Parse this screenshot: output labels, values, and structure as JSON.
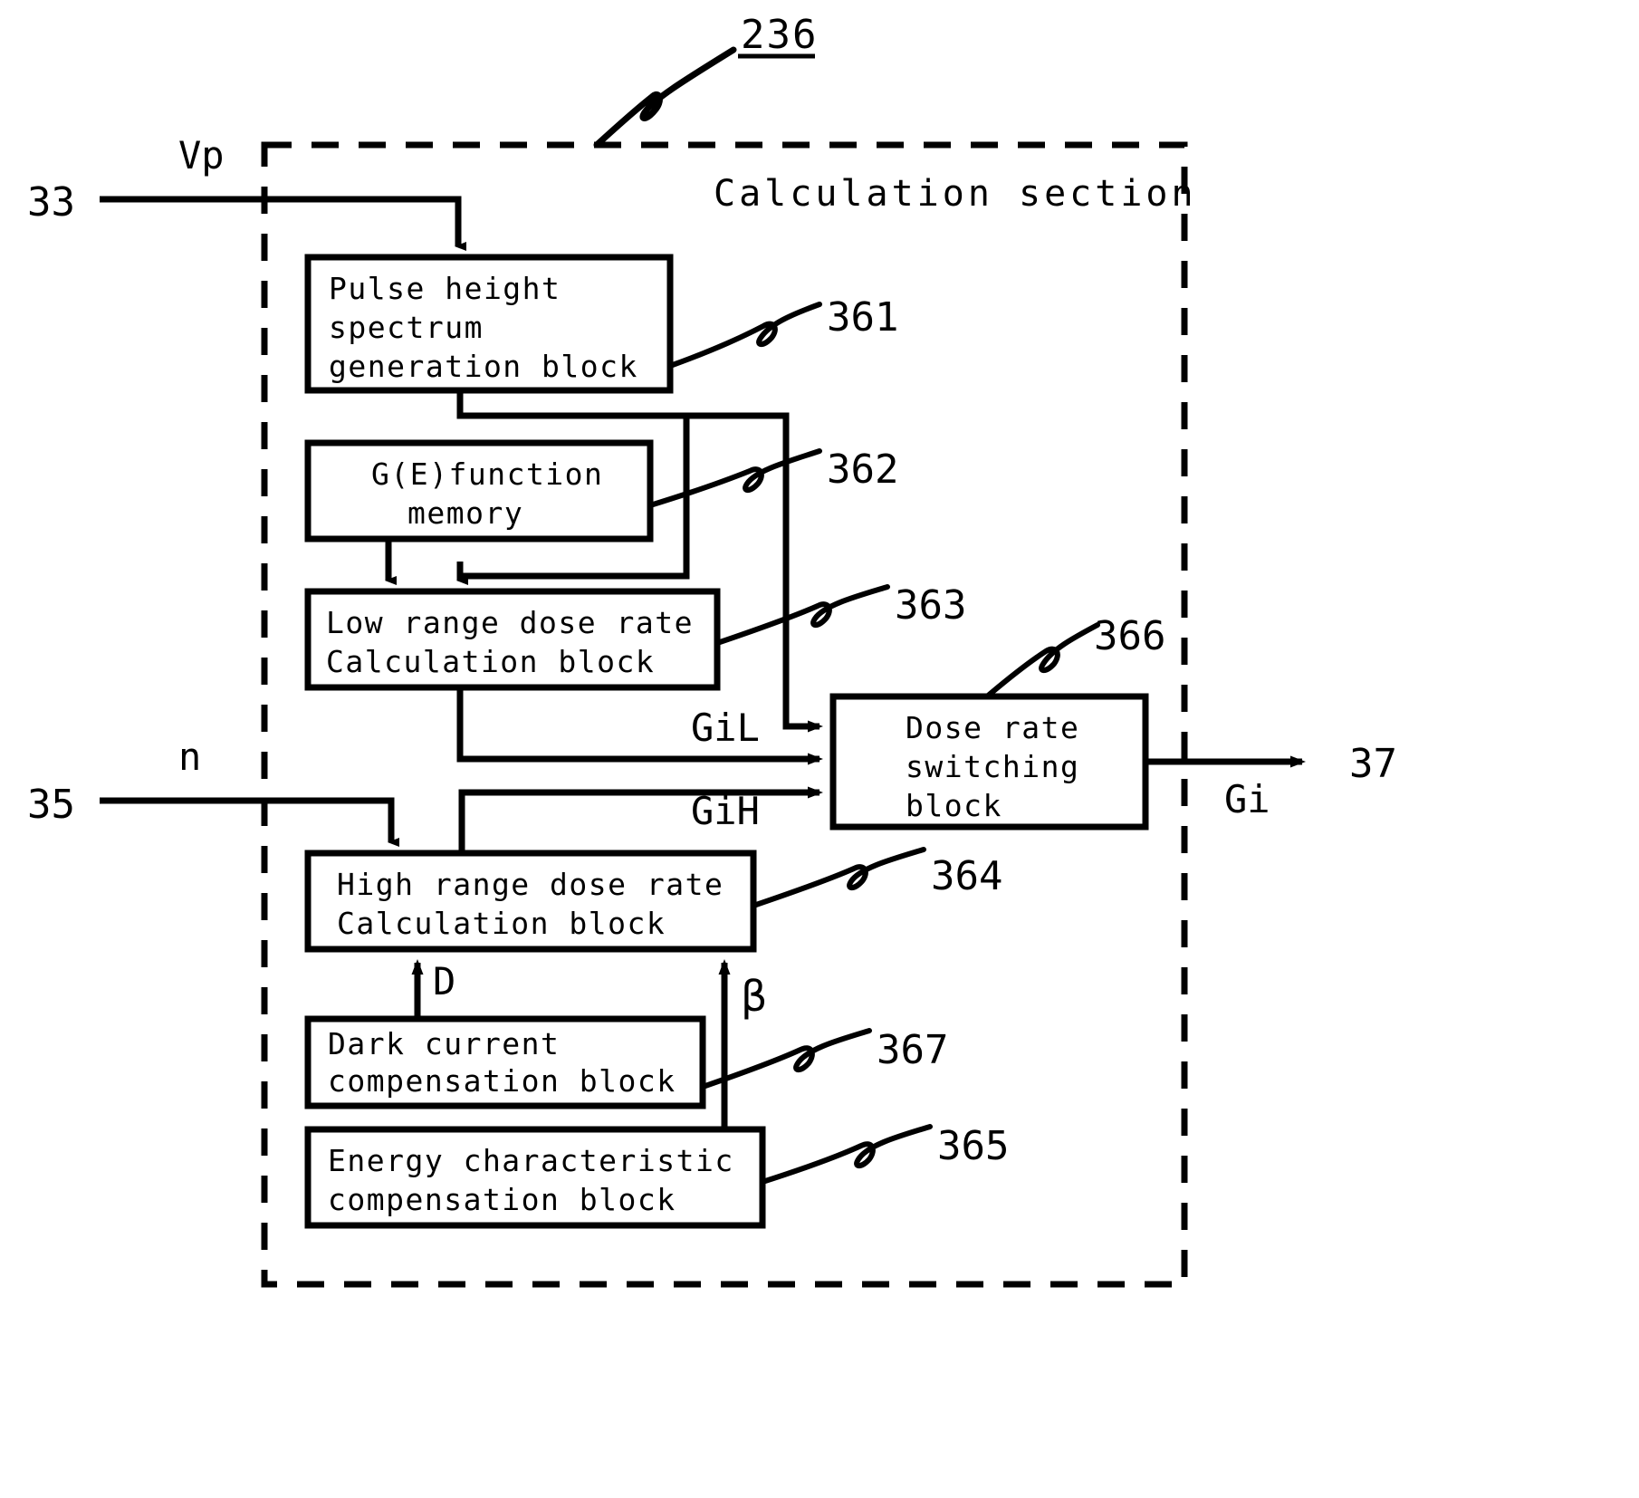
{
  "figure": {
    "reference_numeral": "236",
    "boundary_label": "Calculation section",
    "boundary_style": "dashed"
  },
  "colors": {
    "stroke": "#000000",
    "background": "#ffffff",
    "text": "#000000"
  },
  "blocks": [
    {
      "id": "361",
      "ref": "361",
      "lines": [
        "Pulse height",
        "spectrum",
        "generation block"
      ],
      "align": "left"
    },
    {
      "id": "362",
      "ref": "362",
      "lines": [
        "G(E)function",
        "memory"
      ],
      "align": "center"
    },
    {
      "id": "363",
      "ref": "363",
      "lines": [
        "Low range dose rate",
        "Calculation block"
      ],
      "align": "left"
    },
    {
      "id": "364",
      "ref": "364",
      "lines": [
        "High range dose rate",
        "Calculation block"
      ],
      "align": "left"
    },
    {
      "id": "366",
      "ref": "366",
      "lines": [
        "Dose rate",
        "switching",
        "block"
      ],
      "align": "center"
    },
    {
      "id": "367",
      "ref": "367",
      "lines": [
        "Dark current",
        "compensation block"
      ],
      "align": "left"
    },
    {
      "id": "365",
      "ref": "365",
      "lines": [
        "Energy characteristic",
        "compensation block"
      ],
      "align": "left"
    }
  ],
  "terminals": [
    {
      "id": "in-33",
      "label": "33",
      "signal": "Vp",
      "side": "left"
    },
    {
      "id": "in-35",
      "label": "35",
      "signal": "n",
      "side": "left"
    },
    {
      "id": "out-37",
      "label": "37",
      "signal": "Gi",
      "side": "right"
    }
  ],
  "signal_labels": [
    {
      "id": "vp",
      "text": "Vp"
    },
    {
      "id": "n",
      "text": "n"
    },
    {
      "id": "gil",
      "text": "GiL"
    },
    {
      "id": "gih",
      "text": "GiH"
    },
    {
      "id": "gi",
      "text": "Gi"
    },
    {
      "id": "d",
      "text": "D"
    },
    {
      "id": "beta",
      "text": "β"
    }
  ],
  "reference_numerals": [
    "236",
    "361",
    "362",
    "363",
    "364",
    "365",
    "366",
    "367",
    "33",
    "35",
    "37"
  ]
}
